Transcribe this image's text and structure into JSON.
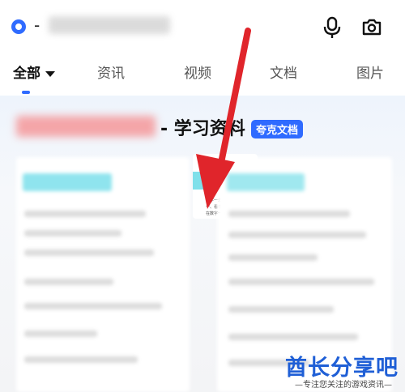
{
  "search": {
    "query_prefix": "-",
    "icons": {
      "brand": "quark-logo-icon",
      "mic": "microphone-icon",
      "camera": "camera-icon"
    }
  },
  "tabs": [
    {
      "label": "全部",
      "active": true
    },
    {
      "label": "资讯"
    },
    {
      "label": "视频"
    },
    {
      "label": "文档"
    },
    {
      "label": "图片"
    }
  ],
  "result": {
    "title": "- 学习资料",
    "badge": "夸克文档",
    "thumbnail_text": {
      "heading": "序一",
      "lines": [
        "数字一年级下学",
        "一、看书题目",
        "在数字一，功放"
      ]
    }
  },
  "watermark": {
    "title": "酋长分享吧",
    "subtitle": "—专注您关注的游戏资讯—"
  },
  "colors": {
    "accent": "#2f6bff",
    "arrow": "#e0252b",
    "watermark": "#1f5fd6"
  }
}
